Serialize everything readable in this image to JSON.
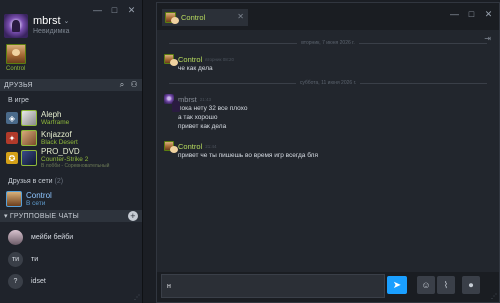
{
  "friends_window": {
    "username": "mbrst",
    "status": "Невидимка",
    "recent": {
      "name": "Control"
    },
    "friends_header": "ДРУЗЬЯ",
    "in_game_label": "В игре",
    "in_game": [
      {
        "name": "Aleph",
        "game": "Warframe",
        "sub": "",
        "icon_color": "#4a6a8a"
      },
      {
        "name": "Knjazzof",
        "game": "Black Desert",
        "sub": "",
        "icon_color": "#b23a2a"
      },
      {
        "name": "PRO_DVD",
        "game": "Counter-Strike 2",
        "sub": "В лобби - Соревновательный",
        "icon_color": "#d4a017"
      }
    ],
    "online_label": "Друзья в сети",
    "online_count": "(2)",
    "online": [
      {
        "name": "Control",
        "status": "В сети"
      }
    ],
    "groupchats_header": "ГРУППОВЫЕ ЧАТЫ",
    "groupchats": [
      {
        "name": "мейби бейби",
        "initials": ""
      },
      {
        "name": "ти",
        "initials": "ти"
      },
      {
        "name": "idset",
        "initials": "?"
      }
    ]
  },
  "chat_window": {
    "tab_name": "Control",
    "dividers": [
      "вторник, 7 июня 2026 г.",
      "суббота, 11 июня 2026 г."
    ],
    "messages": [
      {
        "sender": "Control",
        "time": "вторник 08:20",
        "color": "#b8dc5e",
        "lines": [
          "че как дела"
        ]
      },
      {
        "sender": "mbrst",
        "time": "21:43",
        "color": "#8a909a",
        "lines": [
          "пока нету 32 все плохо",
          "а так хорошо",
          "привет как дела"
        ]
      },
      {
        "sender": "Control",
        "time": "21:44",
        "color": "#b8dc5e",
        "lines": [
          "привет че ты пишешь во время игр всегда бля"
        ]
      }
    ],
    "input_value": "н"
  }
}
